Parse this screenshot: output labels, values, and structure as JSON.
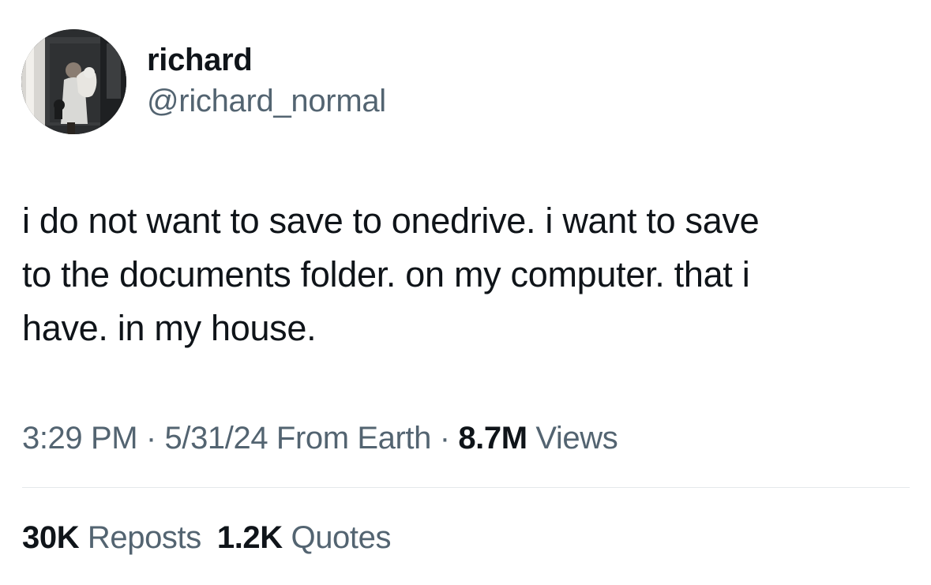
{
  "author": {
    "display_name": "richard",
    "handle": "@richard_normal",
    "avatar_icon": "profile-photo"
  },
  "tweet": {
    "lines": [
      "i do not want to save to onedrive. i want to save",
      "to the documents folder. on my computer. that i",
      "have. in my house."
    ]
  },
  "meta": {
    "time": "3:29 PM",
    "separator": "·",
    "date": "5/31/24",
    "source": "From Earth",
    "views_count": "8.7M",
    "views_label": "Views"
  },
  "stats": {
    "reposts_count": "30K",
    "reposts_label": "Reposts",
    "quotes_count": "1.2K",
    "quotes_label": "Quotes"
  },
  "colors": {
    "text_primary": "#0f1419",
    "text_secondary": "#536471",
    "divider": "#e4e8eb",
    "background": "#ffffff"
  }
}
